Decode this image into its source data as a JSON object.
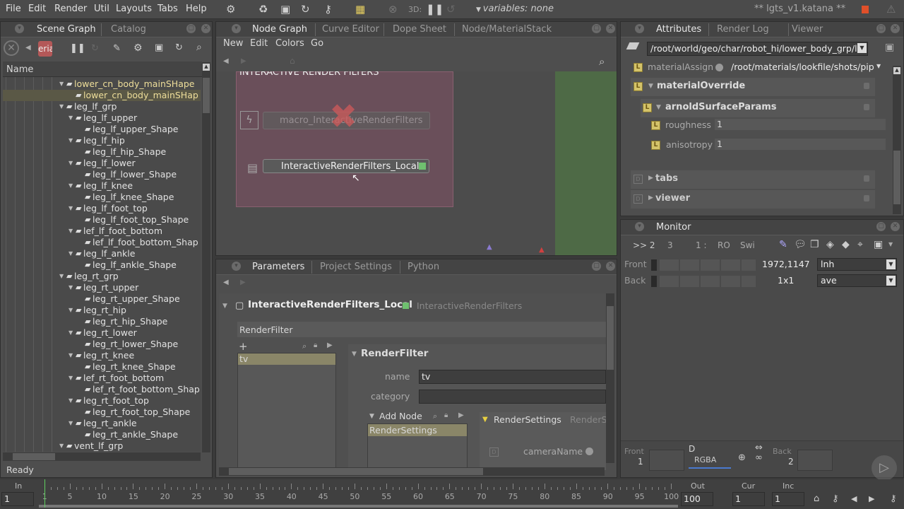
{
  "menubar": {
    "items": [
      "File",
      "Edit",
      "Render",
      "Util",
      "Layouts",
      "Tabs",
      "Help"
    ],
    "threed_label": "3D:",
    "variables": "variables: none",
    "file_title": "** lgts_v1.katana **",
    "render_color": "#e0502a"
  },
  "scene_graph": {
    "tabs": [
      "Scene Graph",
      "Catalog"
    ],
    "toolbar_field": "erialE",
    "column_header": "Name",
    "status": "Ready",
    "items": [
      {
        "label": "lower_cn_body_mainSHape",
        "level": 1,
        "expanded": true,
        "highlight": true
      },
      {
        "label": "lower_cn_body_mainSHap",
        "level": 2,
        "highlight": true,
        "selected": true
      },
      {
        "label": "leg_lf_grp",
        "level": 1,
        "expanded": true
      },
      {
        "label": "leg_lf_upper",
        "level": 2,
        "expanded": true
      },
      {
        "label": "leg_lf_upper_Shape",
        "level": 3
      },
      {
        "label": "leg_lf_hip",
        "level": 2,
        "expanded": true
      },
      {
        "label": "leg_lf_hip_Shape",
        "level": 3
      },
      {
        "label": "leg_lf_lower",
        "level": 2,
        "expanded": true
      },
      {
        "label": "leg_lf_lower_Shape",
        "level": 3
      },
      {
        "label": "leg_lf_knee",
        "level": 2,
        "expanded": true
      },
      {
        "label": "leg_lf_knee_Shape",
        "level": 3
      },
      {
        "label": "leg_lf_foot_top",
        "level": 2,
        "expanded": true
      },
      {
        "label": "leg_lf_foot_top_Shape",
        "level": 3
      },
      {
        "label": "lef_lf_foot_bottom",
        "level": 2,
        "expanded": true
      },
      {
        "label": "lef_lf_foot_bottom_Shap",
        "level": 3
      },
      {
        "label": "leg_lf_ankle",
        "level": 2,
        "expanded": true
      },
      {
        "label": "leg_lf_ankle_Shape",
        "level": 3
      },
      {
        "label": "leg_rt_grp",
        "level": 1,
        "expanded": true
      },
      {
        "label": "leg_rt_upper",
        "level": 2,
        "expanded": true
      },
      {
        "label": "leg_rt_upper_Shape",
        "level": 3
      },
      {
        "label": "leg_rt_hip",
        "level": 2,
        "expanded": true
      },
      {
        "label": "leg_rt_hip_Shape",
        "level": 3
      },
      {
        "label": "leg_rt_lower",
        "level": 2,
        "expanded": true
      },
      {
        "label": "leg_rt_lower_Shape",
        "level": 3
      },
      {
        "label": "leg_rt_knee",
        "level": 2,
        "expanded": true
      },
      {
        "label": "leg_rt_knee_Shape",
        "level": 3
      },
      {
        "label": "lef_rt_foot_bottom",
        "level": 2,
        "expanded": true
      },
      {
        "label": "lef_rt_foot_bottom_Shap",
        "level": 3
      },
      {
        "label": "leg_rt_foot_top",
        "level": 2,
        "expanded": true
      },
      {
        "label": "leg_rt_foot_top_Shape",
        "level": 3
      },
      {
        "label": "leg_rt_ankle",
        "level": 2,
        "expanded": true
      },
      {
        "label": "leg_rt_ankle_Shape",
        "level": 3
      },
      {
        "label": "vent_lf_grp",
        "level": 1,
        "expanded": true
      }
    ]
  },
  "node_graph": {
    "tabs": [
      "Node Graph",
      "Curve Editor",
      "Dope Sheet",
      "Node/MaterialStack"
    ],
    "menu": [
      "New",
      "Edit",
      "Colors",
      "Go"
    ],
    "backdrop_title": "INTERACTIVE RENDER FILTERS",
    "nodes": [
      "macro_InteractiveRenderFilters",
      "InteractiveRenderFilters_Local"
    ]
  },
  "parameters": {
    "tabs": [
      "Parameters",
      "Project Settings",
      "Python"
    ],
    "node_name": "InteractiveRenderFilters_Local",
    "node_type": "InteractiveRenderFilters",
    "section": "RenderFilter",
    "list_items": [
      "tv"
    ],
    "group_title": "RenderFilter",
    "name_label": "name",
    "name_value": "tv",
    "category_label": "category",
    "category_value": "",
    "add_node_label": "Add Node",
    "add_node_items": [
      "RenderSettings"
    ],
    "render_settings_title": "RenderSettings",
    "render_settings_type": "RenderS",
    "camera_label": "cameraName"
  },
  "attributes": {
    "tabs": [
      "Attributes",
      "Render Log",
      "Viewer"
    ],
    "path": "/root/world/geo/char/robot_hi/lower_body_grp/lo",
    "material_assign_label": "materialAssign",
    "material_assign_value": "/root/materials/lookfile/shots/pip",
    "material_override": "materialOverride",
    "arnold_params": "arnoldSurfaceParams",
    "roughness_label": "roughness",
    "roughness_value": "1",
    "anisotropy_label": "anisotropy",
    "anisotropy_value": "1",
    "tabs_group": "tabs",
    "viewer_group": "viewer"
  },
  "monitor": {
    "tab": "Monitor",
    "toolbar": [
      ">> 2",
      "3",
      "1 :",
      "RO",
      "Swi"
    ],
    "front_label": "Front",
    "back_label": "Back",
    "resolution": "1972,1147",
    "ratio": "1x1",
    "front_select": "lnh",
    "back_select": "ave",
    "bottom_front": "Front",
    "bottom_front_num": "1",
    "bottom_back": "Back",
    "bottom_back_num": "2",
    "channel": "RGBA",
    "d_label": "D"
  },
  "timeline": {
    "in_label": "In",
    "in_value": "1",
    "out_label": "Out",
    "out_value": "100",
    "cur_label": "Cur",
    "cur_value": "1",
    "inc_label": "Inc",
    "inc_value": "1",
    "tick_labels": [
      "1",
      "5",
      "10",
      "15",
      "20",
      "25",
      "30",
      "35",
      "40",
      "45",
      "50",
      "55",
      "60",
      "65",
      "70",
      "75",
      "80",
      "85",
      "90",
      "95",
      "100"
    ],
    "current_frame": 1
  }
}
